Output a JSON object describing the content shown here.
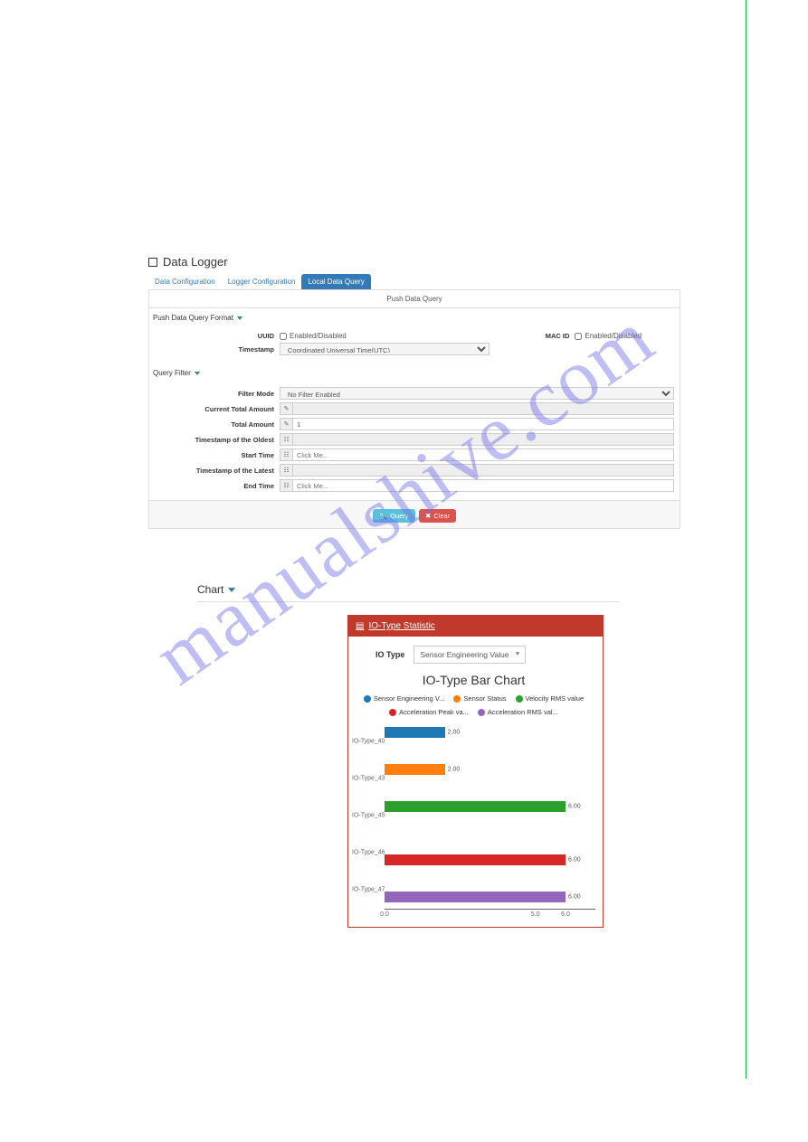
{
  "watermark": "manualshive.com",
  "dataLogger": {
    "title": "Data Logger",
    "tabs": [
      "Data Configuration",
      "Logger Configuration",
      "Local Data Query"
    ],
    "activeTab": 2,
    "panelTitle": "Push Data Query",
    "section1": "Push Data Query Format",
    "uuid": {
      "label": "UUID",
      "chk": "Enabled/Disabled"
    },
    "macid": {
      "label": "MAC ID",
      "chk": "Enabled/Disabled"
    },
    "timestamp": {
      "label": "Timestamp",
      "value": "Coordinated Universal Time(UTC)"
    },
    "section2": "Query Filter",
    "filterMode": {
      "label": "Filter Mode",
      "value": "No Filter Enabled"
    },
    "curTotal": {
      "label": "Current Total Amount",
      "icon": "✎"
    },
    "total": {
      "label": "Total Amount",
      "icon": "✎",
      "value": "1"
    },
    "tsOldest": {
      "label": "Timestamp of the Oldest",
      "icon": "☷"
    },
    "startTime": {
      "label": "Start Time",
      "icon": "☷",
      "placeholder": "Click Me..."
    },
    "tsLatest": {
      "label": "Timestamp of the Latest",
      "icon": "☷"
    },
    "endTime": {
      "label": "End Time",
      "icon": "☷",
      "placeholder": "Click Me..."
    },
    "btnQuery": "Query",
    "btnClear": "Clear"
  },
  "chartSection": {
    "header": "Chart",
    "redHeader": "IO-Type Statistic",
    "ioTypeLabel": "IO Type",
    "ioTypeValue": "Sensor Engineering Value"
  },
  "chart_data": {
    "type": "bar",
    "title": "IO-Type Bar Chart",
    "orientation": "horizontal",
    "xlim": [
      0,
      6
    ],
    "xticks": [
      0.0,
      5.0,
      6.0
    ],
    "categories": [
      "IO-Type_40",
      "IO-Type_43",
      "IO-Type_45",
      "IO-Type_46",
      "IO-Type_47"
    ],
    "legend": [
      {
        "name": "Sensor Engineering V...",
        "color": "#1f77b4"
      },
      {
        "name": "Sensor Status",
        "color": "#ff7f0e"
      },
      {
        "name": "Velocity RMS value",
        "color": "#2ca02c"
      },
      {
        "name": "Acceleration Peak va...",
        "color": "#d62728"
      },
      {
        "name": "Acceleration RMS val...",
        "color": "#9467bd"
      }
    ],
    "bars": [
      {
        "cat": "IO-Type_40",
        "series": 0,
        "value": 2.0,
        "slot": 0
      },
      {
        "cat": "IO-Type_43",
        "series": 1,
        "value": 2.0,
        "slot": 0
      },
      {
        "cat": "IO-Type_45",
        "series": 2,
        "value": 6.0,
        "slot": 0
      },
      {
        "cat": "IO-Type_46",
        "series": 3,
        "value": 6.0,
        "slot": 1
      },
      {
        "cat": "IO-Type_47",
        "series": 4,
        "value": 6.0,
        "slot": 1
      }
    ]
  }
}
